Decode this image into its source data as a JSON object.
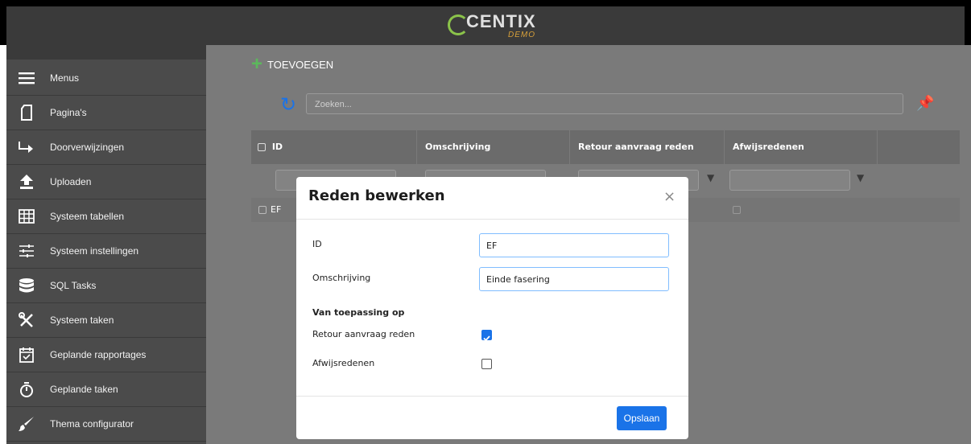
{
  "header": {
    "logo_text": "CENTIX",
    "logo_sub": "DEMO"
  },
  "sidebar": {
    "items": [
      {
        "label": "Menus",
        "icon": "hamburger-menu-icon"
      },
      {
        "label": "Pagina's",
        "icon": "page-icon"
      },
      {
        "label": "Doorverwijzingen",
        "icon": "redirect-arrow-icon"
      },
      {
        "label": "Uploaden",
        "icon": "upload-icon"
      },
      {
        "label": "Systeem tabellen",
        "icon": "table-grid-icon"
      },
      {
        "label": "Systeem instellingen",
        "icon": "sliders-icon"
      },
      {
        "label": "SQL Tasks",
        "icon": "database-icon"
      },
      {
        "label": "Systeem taken",
        "icon": "tools-icon"
      },
      {
        "label": "Geplande rapportages",
        "icon": "calendar-check-icon"
      },
      {
        "label": "Geplande taken",
        "icon": "stopwatch-icon"
      },
      {
        "label": "Thema configurator",
        "icon": "brush-icon"
      }
    ]
  },
  "toolbar": {
    "add_label": "TOEVOEGEN"
  },
  "search": {
    "placeholder": "Zoeken..."
  },
  "grid": {
    "columns": [
      "ID",
      "Omschrijving",
      "Retour aanvraag reden",
      "Afwijsredenen"
    ],
    "rows": [
      {
        "id": "EF"
      }
    ]
  },
  "modal": {
    "title": "Reden bewerken",
    "close": "×",
    "id_label": "ID",
    "id_value": "EF",
    "desc_label": "Omschrijving",
    "desc_value": "Einde fasering",
    "section_title": "Van toepassing op",
    "retour_label": "Retour aanvraag reden",
    "retour_checked": true,
    "afwijs_label": "Afwijsredenen",
    "afwijs_checked": false,
    "save_label": "Opslaan"
  },
  "colors": {
    "accent": "#1a73e8",
    "add_green": "#5cb85c",
    "sidebar_bg": "#4b4b4b"
  }
}
